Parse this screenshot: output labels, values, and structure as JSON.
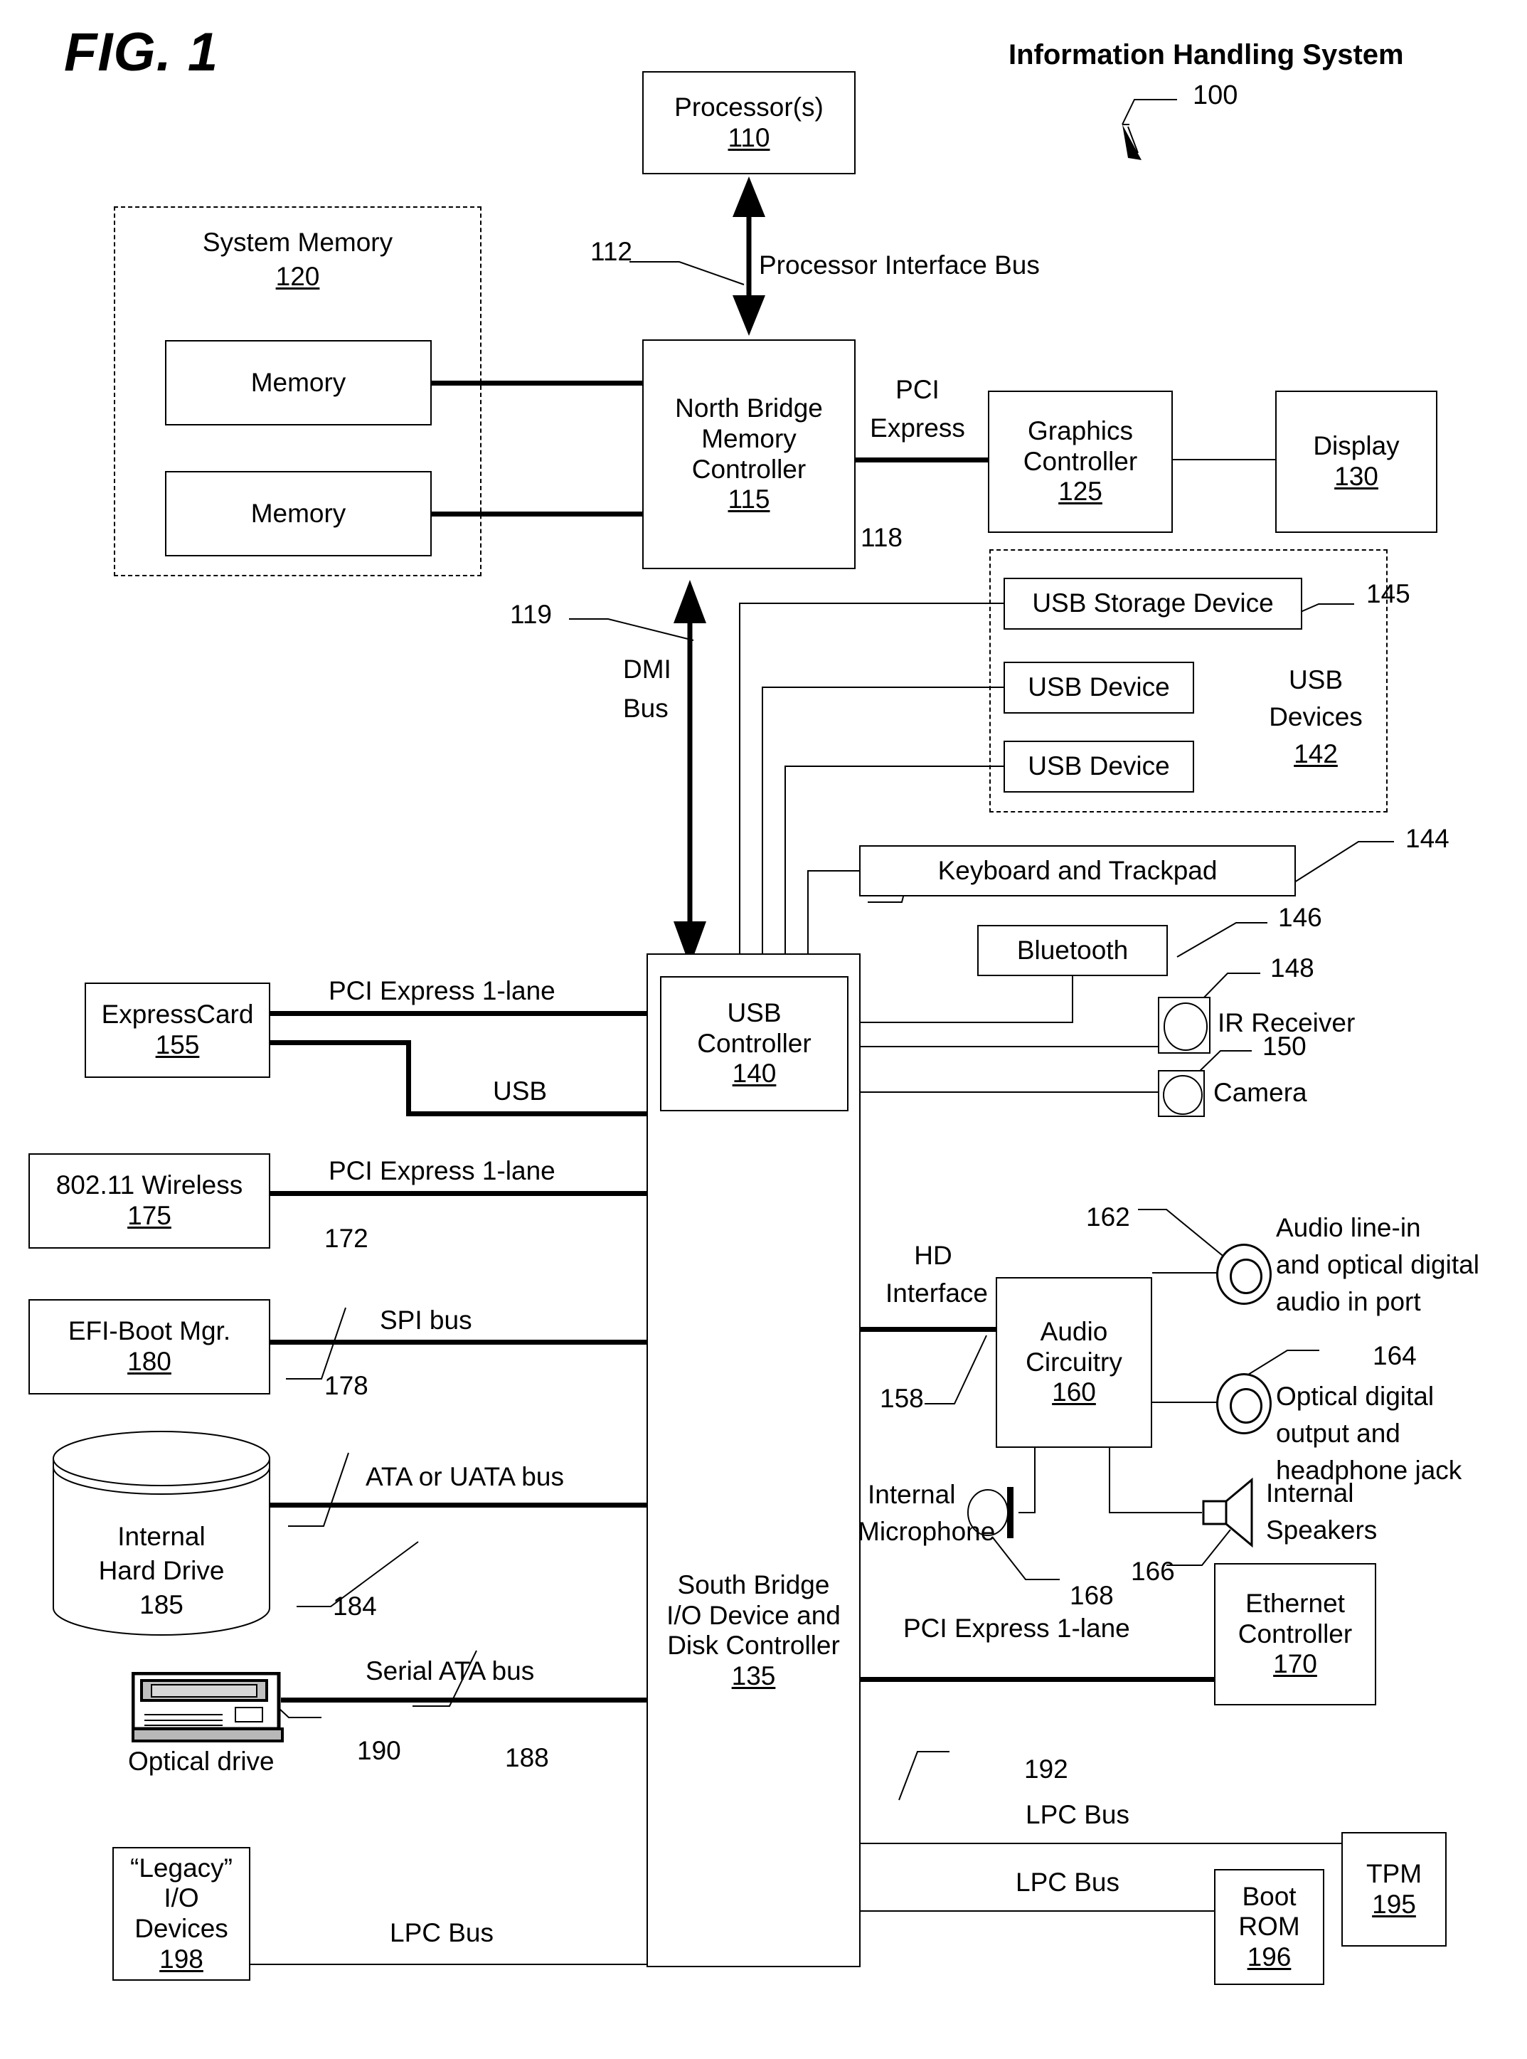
{
  "figure": {
    "fig_label": "FIG. 1",
    "system_title": "Information Handling System",
    "system_ref": "100"
  },
  "blocks": {
    "processor": {
      "title": "Processor(s)",
      "ref": "110"
    },
    "north_bridge": {
      "line1": "North Bridge",
      "line2": "Memory",
      "line3": "Controller",
      "ref": "115"
    },
    "system_memory": {
      "title": "System Memory",
      "ref": "120",
      "memory1": "Memory",
      "memory2": "Memory"
    },
    "graphics_controller": {
      "line1": "Graphics",
      "line2": "Controller",
      "ref": "125"
    },
    "display": {
      "title": "Display",
      "ref": "130"
    },
    "south_bridge": {
      "line1": "South Bridge",
      "line2": "I/O Device and",
      "line3": "Disk Controller",
      "ref": "135"
    },
    "usb_controller": {
      "line1": "USB",
      "line2": "Controller",
      "ref": "140"
    },
    "usb_devices_group": {
      "line1": "USB",
      "line2": "Devices",
      "ref": "142"
    },
    "usb_storage_device": {
      "title": "USB Storage Device",
      "ref": "145"
    },
    "usb_device_1": {
      "title": "USB Device"
    },
    "usb_device_2": {
      "title": "USB Device"
    },
    "keyboard_trackpad": {
      "title": "Keyboard and Trackpad",
      "ref": "144"
    },
    "bluetooth": {
      "title": "Bluetooth",
      "ref": "146"
    },
    "ir_receiver": {
      "title": "IR Receiver",
      "ref": "148"
    },
    "camera": {
      "title": "Camera",
      "ref": "150"
    },
    "expresscard": {
      "title": "ExpressCard",
      "ref": "155"
    },
    "audio_circuitry": {
      "line1": "Audio",
      "line2": "Circuitry",
      "ref": "160"
    },
    "audio_line_in": {
      "line1": "Audio line-in",
      "line2": "and optical digital",
      "line3": "audio in port",
      "ref": "162"
    },
    "optical_digital_out": {
      "line1": "Optical digital",
      "line2": "output and",
      "line3": "headphone jack",
      "ref": "164"
    },
    "internal_speakers": {
      "line1": "Internal",
      "line2": "Speakers",
      "ref": "166"
    },
    "internal_microphone": {
      "line1": "Internal",
      "line2": "Microphone",
      "ref": "168"
    },
    "ethernet_controller": {
      "line1": "Ethernet",
      "line2": "Controller",
      "ref": "170"
    },
    "wireless": {
      "title": "802.11 Wireless",
      "ref": "175"
    },
    "efi_boot_mgr": {
      "title": "EFI-Boot Mgr.",
      "ref": "180"
    },
    "internal_hard_drive": {
      "line1": "Internal",
      "line2": "Hard Drive",
      "ref": "185"
    },
    "optical_drive": {
      "title": "Optical drive",
      "ref": "190"
    },
    "tpm": {
      "title": "TPM",
      "ref": "195"
    },
    "boot_rom": {
      "line1": "Boot",
      "line2": "ROM",
      "ref": "196"
    },
    "legacy_io": {
      "line1": "“Legacy”",
      "line2": "I/O",
      "line3": "Devices",
      "ref": "198"
    }
  },
  "buses": {
    "processor_interface_bus": {
      "label": "Processor Interface Bus",
      "ref": "112"
    },
    "pci_express_graphics": {
      "line1": "PCI",
      "line2": "Express",
      "ref": "118"
    },
    "dmi_bus": {
      "line1": "DMI",
      "line2": "Bus",
      "ref": "119"
    },
    "pci_express_expresscard": {
      "label": "PCI Express 1-lane"
    },
    "usb_expresscard": {
      "label": "USB"
    },
    "pci_express_wireless": {
      "label": "PCI Express 1-lane",
      "ref": "172"
    },
    "spi_bus": {
      "label": "SPI bus",
      "ref": "178"
    },
    "ata_bus": {
      "label": "ATA or UATA bus",
      "ref": "184"
    },
    "serial_ata_bus": {
      "label": "Serial ATA bus",
      "ref": "188"
    },
    "hd_interface": {
      "line1": "HD",
      "line2": "Interface",
      "ref": "158"
    },
    "pci_express_ethernet": {
      "label": "PCI Express 1-lane"
    },
    "lpc_bus_tpm": {
      "label": "LPC Bus",
      "ref": "192"
    },
    "lpc_bus_boot_rom": {
      "label": "LPC Bus"
    },
    "lpc_bus_legacy": {
      "label": "LPC Bus"
    }
  },
  "colors": {
    "ink": "#000000",
    "paper": "#ffffff",
    "icon_fill": "#c0c0c0"
  }
}
